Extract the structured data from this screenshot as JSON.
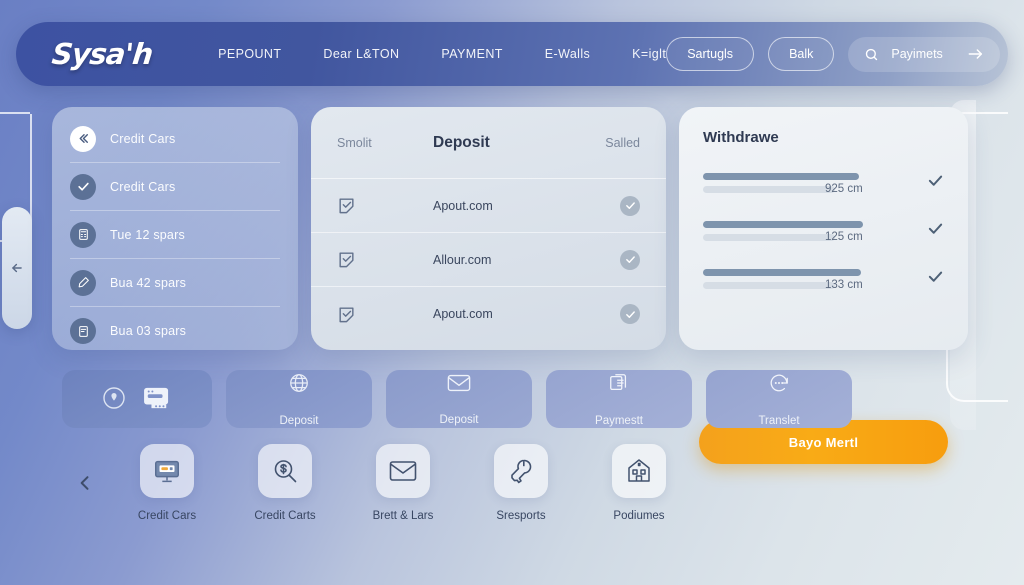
{
  "header": {
    "logo": "Sysa'h",
    "nav": [
      {
        "label": "PEPOUNT"
      },
      {
        "label": "Dear L&TON"
      },
      {
        "label": "PAYMENT"
      },
      {
        "label": "E-Walls"
      },
      {
        "label": "K=iglt"
      }
    ],
    "buttons": [
      {
        "label": "Sartugls"
      },
      {
        "label": "Balk"
      }
    ],
    "search": {
      "label": "Payimets",
      "icon": "search-icon",
      "trailing_icon": "arrow-right-icon"
    },
    "accent_bg": "#3d52a2"
  },
  "left_panel": {
    "items": [
      {
        "label": "Credit Cars",
        "icon": "double-chevron-left-icon",
        "badge": "white"
      },
      {
        "label": "Credit Cars",
        "icon": "check-icon",
        "badge": "blue"
      },
      {
        "label": "Tue 12 spars",
        "icon": "calculator-icon",
        "badge": "blue"
      },
      {
        "label": "Bua 42 spars",
        "icon": "pen-icon",
        "badge": "blue"
      },
      {
        "label": "Bua 03 spars",
        "icon": "book-icon",
        "badge": "blue"
      }
    ]
  },
  "mid_panel": {
    "columns": {
      "c1": "Smolit",
      "c2": "Deposit",
      "c3": "Salled"
    },
    "rows": [
      {
        "name": "Apout.com",
        "icon": "checkbox-check-icon",
        "status": "check-circle-icon"
      },
      {
        "name": "Allour.com",
        "icon": "checkbox-check-icon",
        "status": "check-circle-icon"
      },
      {
        "name": "Apout.com",
        "icon": "checkbox-check-icon",
        "status": "check-circle-icon"
      }
    ]
  },
  "right_panel": {
    "title": "Withdrawe",
    "rows": [
      {
        "value": "925 cm",
        "fill_pct": 78,
        "status": "check-icon"
      },
      {
        "value": "125 cm",
        "fill_pct": 80,
        "status": "check-icon"
      },
      {
        "value": "133 cm",
        "fill_pct": 79,
        "status": "check-icon"
      }
    ],
    "action_button": {
      "label": "Bayo Mertl",
      "color": "#f7a418"
    }
  },
  "tile_row": [
    {
      "label": "",
      "icons": [
        "location-pin-icon",
        "card-window-icon"
      ]
    },
    {
      "label": "Deposit",
      "icon": "globe-icon"
    },
    {
      "label": "Deposit",
      "icon": "envelope-icon"
    },
    {
      "label": "Paymestt",
      "icon": "document-copy-icon"
    },
    {
      "label": "Translet",
      "icon": "refresh-dots-icon"
    }
  ],
  "bottom_row": {
    "back_icon": "chevron-left-icon",
    "items": [
      {
        "label": "Credit Cars",
        "icon": "monitor-card-icon"
      },
      {
        "label": "Credit Carts",
        "icon": "dollar-search-icon"
      },
      {
        "label": "Brett & Lars",
        "icon": "envelope-icon"
      },
      {
        "label": "Sresports",
        "icon": "wrench-icon"
      },
      {
        "label": "Podiumes",
        "icon": "building-icon"
      }
    ]
  },
  "edges": {
    "left_handle_icon": "arrow-left-icon"
  }
}
